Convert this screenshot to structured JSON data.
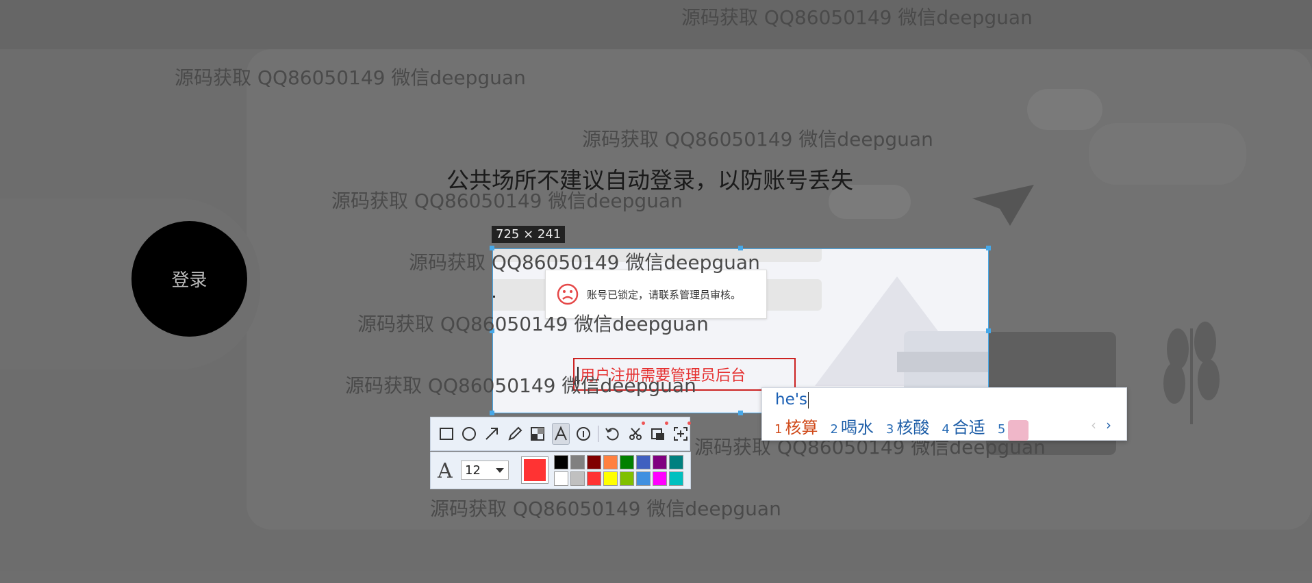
{
  "headline": "公共场所不建议自动登录，以防账号丢失",
  "login_button": "登录",
  "watermark": "源码获取 QQ86050149 微信deepguan",
  "selection_size": "725 × 241",
  "alert_text": "账号已锁定，请联系管理员审核。",
  "textbox_text": "用户注册需要管理员后台",
  "font_size_value": "12",
  "colors": {
    "current": "#ff3333",
    "selection_border": "#47a8e8",
    "palette": [
      "#000000",
      "#808080",
      "#800000",
      "#ff8040",
      "#008000",
      "#4060c0",
      "#800080",
      "#008080",
      "#ffffff",
      "#c0c0c0",
      "#ff3333",
      "#ffff00",
      "#80c000",
      "#4090e0",
      "#ff00ff",
      "#00c0c0"
    ]
  },
  "toolbar": {
    "tools": [
      "rectangle-icon",
      "ellipse-icon",
      "arrow-icon",
      "pencil-icon",
      "mosaic-icon",
      "text-icon",
      "number-icon",
      "undo-icon",
      "cut-icon",
      "pin-icon",
      "fullscreen-icon"
    ]
  },
  "ime": {
    "input": "he's",
    "candidates": [
      {
        "num": "1",
        "text": "核算"
      },
      {
        "num": "2",
        "text": "喝水"
      },
      {
        "num": "3",
        "text": "核酸"
      },
      {
        "num": "4",
        "text": "合适"
      },
      {
        "num": "5",
        "text": ""
      }
    ],
    "prev": "‹",
    "next": "›"
  }
}
